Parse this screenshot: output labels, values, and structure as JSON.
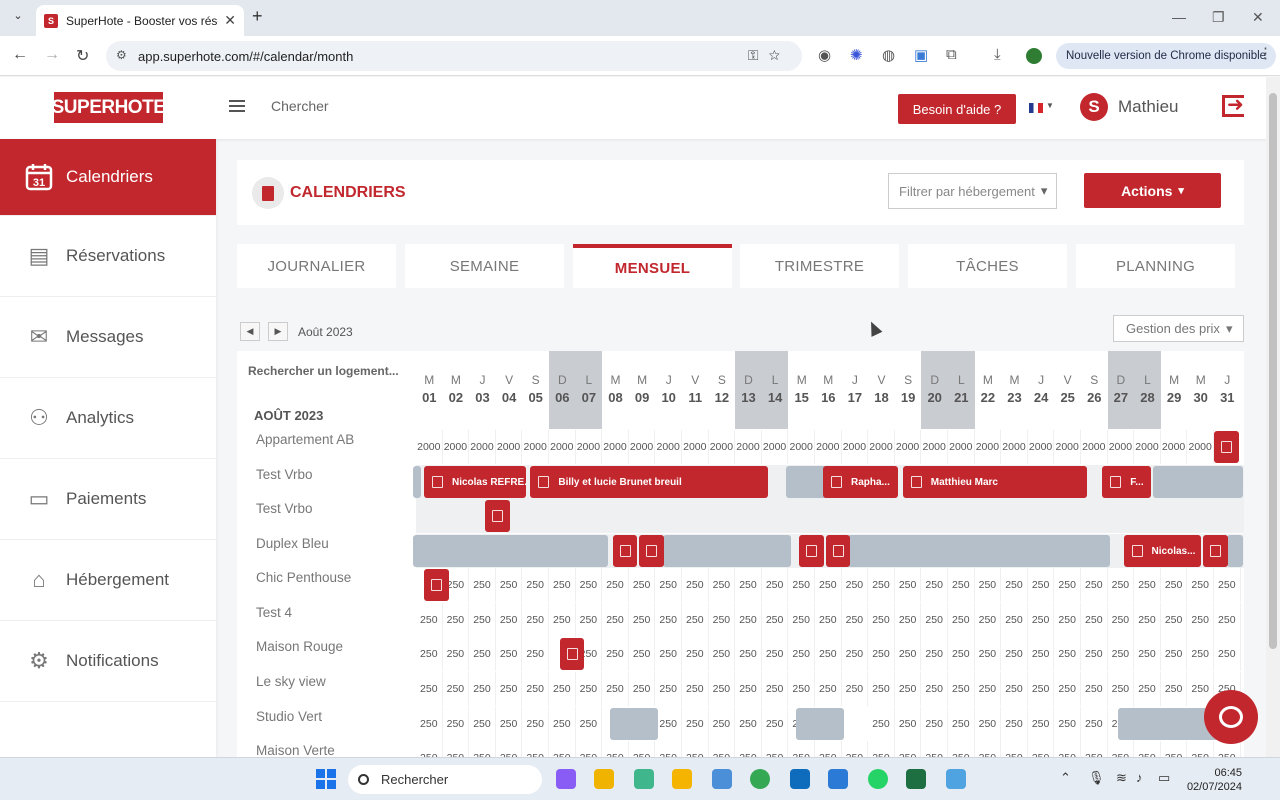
{
  "browser": {
    "tab_title": "SuperHote - Booster vos réserv",
    "tab_favicon": "S",
    "url": "app.superhote.com/#/calendar/month",
    "update_notice": "Nouvelle version de Chrome disponible"
  },
  "header": {
    "logo": "SUPERHOTE",
    "search_label": "Chercher",
    "help_button": "Besoin d'aide ?",
    "avatar_letter": "S",
    "user_name": "Mathieu"
  },
  "sidebar": {
    "items": [
      {
        "label": "Calendriers",
        "icon": "calendar-31-icon",
        "active": true
      },
      {
        "label": "Réservations",
        "icon": "document-icon"
      },
      {
        "label": "Messages",
        "icon": "envelope-icon"
      },
      {
        "label": "Analytics",
        "icon": "analytics-icon"
      },
      {
        "label": "Paiements",
        "icon": "card-icon"
      },
      {
        "label": "Hébergement",
        "icon": "house-icon"
      },
      {
        "label": "Notifications",
        "icon": "gear-icon"
      }
    ],
    "calendar_icon_number": "31"
  },
  "main": {
    "title": "CALENDRIERS",
    "filter_placeholder": "Filtrer par hébergement",
    "actions_button": "Actions",
    "tabs": [
      "JOURNALIER",
      "SEMAINE",
      "MENSUEL",
      "TRIMESTRE",
      "TÂCHES",
      "PLANNING"
    ],
    "active_tab": "MENSUEL",
    "month_label": "Août 2023",
    "price_dropdown": "Gestion des prix",
    "search_lodging": "Rechercher un logement...",
    "group_label": "AOÛT 2023"
  },
  "calendar": {
    "day_letters": [
      "M",
      "M",
      "J",
      "V",
      "S",
      "D",
      "L",
      "M",
      "M",
      "J",
      "V",
      "S",
      "D",
      "L",
      "M",
      "M",
      "J",
      "V",
      "S",
      "D",
      "L",
      "M",
      "M",
      "J",
      "V",
      "S",
      "D",
      "L",
      "M",
      "M",
      "J"
    ],
    "day_numbers": [
      "01",
      "02",
      "03",
      "04",
      "05",
      "06",
      "07",
      "08",
      "09",
      "10",
      "11",
      "12",
      "13",
      "14",
      "15",
      "16",
      "17",
      "18",
      "19",
      "20",
      "21",
      "22",
      "23",
      "24",
      "25",
      "26",
      "27",
      "28",
      "29",
      "30",
      "31"
    ],
    "weekend_columns": [
      5,
      6,
      12,
      13,
      19,
      20,
      26,
      27
    ],
    "properties": [
      "Appartement AB",
      "Test Vrbo",
      "Test Vrbo",
      "Duplex Bleu",
      "Chic Penthouse",
      "Test 4",
      "Maison Rouge",
      "Le sky view",
      "Studio Vert",
      "Maison Verte"
    ],
    "price_ab": "2000",
    "price_default": "250",
    "reservations": [
      {
        "row": 1,
        "label": "Nicolas REFRE..."
      },
      {
        "row": 1,
        "label": "Billy et lucie Brunet breuil"
      },
      {
        "row": 1,
        "label": "Rapha..."
      },
      {
        "row": 1,
        "label": "Matthieu Marc"
      },
      {
        "row": 1,
        "label": "F..."
      },
      {
        "row": 3,
        "label": "Nicolas..."
      }
    ]
  },
  "taskbar": {
    "search": "Rechercher",
    "time": "06:45",
    "date": "02/07/2024"
  },
  "colors": {
    "brand": "#c1272d",
    "blocked": "#b5bfca"
  }
}
